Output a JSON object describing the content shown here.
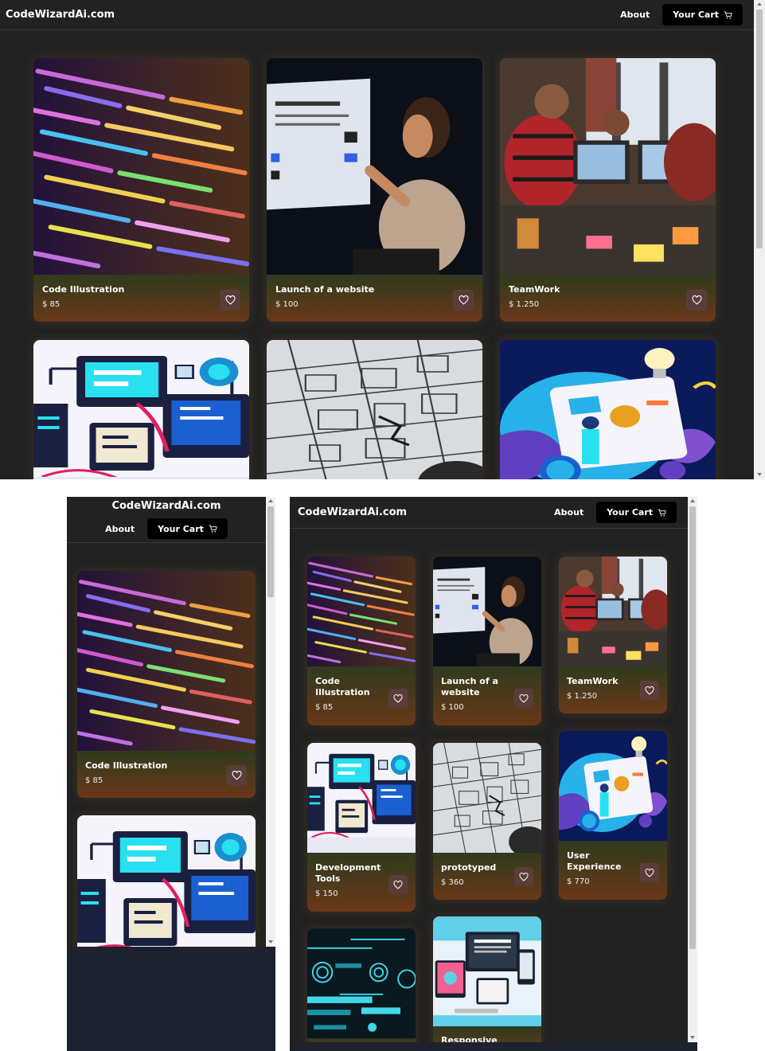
{
  "brand": "CodeWizardAi.com",
  "nav": {
    "about": "About",
    "cart": "Your Cart"
  },
  "products": [
    {
      "title": "Code Illustration",
      "price": "$ 85",
      "image": "code-illustration"
    },
    {
      "title": "Launch of a website",
      "price": "$ 100",
      "image": "launch-website"
    },
    {
      "title": "TeamWork",
      "price": "$ 1.250",
      "image": "teamwork"
    },
    {
      "title": "Development Tools",
      "price": "$ 150",
      "image": "development-tools"
    },
    {
      "title": "prototyped",
      "price": "$ 360",
      "image": "prototype-sketch"
    },
    {
      "title": "User Experience",
      "price": "$ 770",
      "image": "user-experience"
    },
    {
      "title": "",
      "price": "",
      "image": "futuristic-interface"
    },
    {
      "title": "Responsive",
      "price": "",
      "image": "responsive-devices"
    }
  ],
  "colors": {
    "background": "#222222",
    "card_footer_top": "#2f3a1e",
    "card_footer_bottom": "#6a3818",
    "cart_button": "#000000",
    "heart_button": "#5a3d3a"
  },
  "icons": {
    "cart": "shopping-cart-icon",
    "favorite": "heart-icon"
  }
}
